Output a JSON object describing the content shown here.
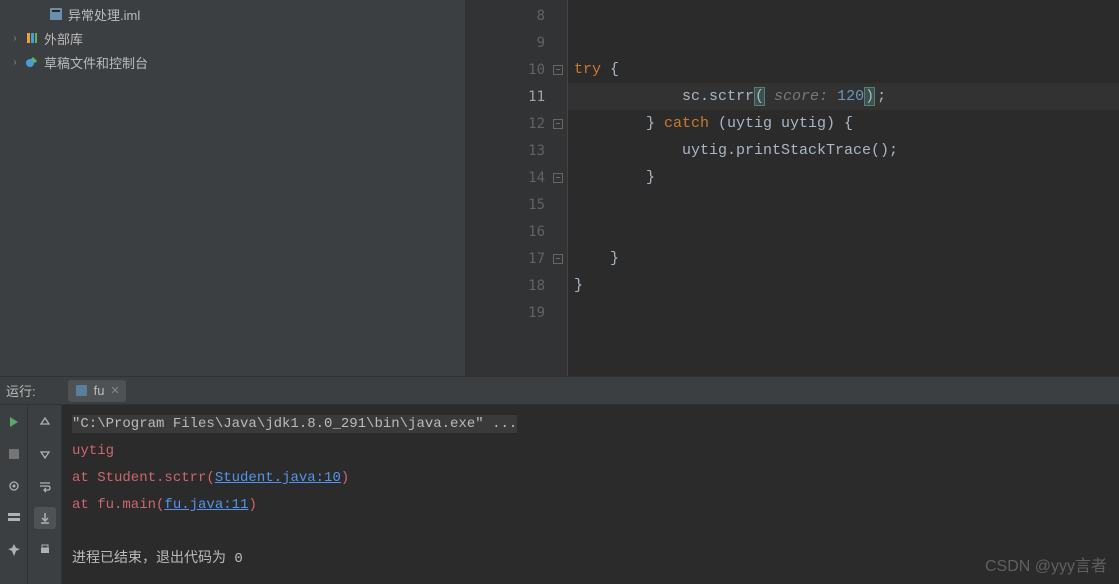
{
  "sidebar": {
    "items": [
      {
        "label": "异常处理.iml",
        "icon": "module-file-icon",
        "indent": "indent1",
        "chevron": ""
      },
      {
        "label": "外部库",
        "icon": "library-icon",
        "indent": "indent0",
        "chevron": "›"
      },
      {
        "label": "草稿文件和控制台",
        "icon": "scratch-icon",
        "indent": "indent0",
        "chevron": "›"
      }
    ]
  },
  "editor": {
    "lines": [
      {
        "num": "8",
        "fold": false,
        "current": false
      },
      {
        "num": "9",
        "fold": false,
        "current": false
      },
      {
        "num": "10",
        "fold": true,
        "current": false
      },
      {
        "num": "11",
        "fold": false,
        "current": true
      },
      {
        "num": "12",
        "fold": true,
        "current": false
      },
      {
        "num": "13",
        "fold": false,
        "current": false
      },
      {
        "num": "14",
        "fold": true,
        "current": false
      },
      {
        "num": "15",
        "fold": false,
        "current": false
      },
      {
        "num": "16",
        "fold": false,
        "current": false
      },
      {
        "num": "17",
        "fold": true,
        "current": false
      },
      {
        "num": "18",
        "fold": false,
        "current": false
      },
      {
        "num": "19",
        "fold": false,
        "current": false
      }
    ],
    "code": {
      "l10_kw": "try",
      "l10_rest": " {",
      "l11_pre": "            sc.sctrr",
      "l11_hint": " score: ",
      "l11_num": "120",
      "l11_end": ";",
      "l12_pre": "        } ",
      "l12_kw": "catch",
      "l12_rest": " (uytig uytig) {",
      "l13": "            uytig.printStackTrace();",
      "l14": "        }",
      "l17": "    }",
      "l18": "}"
    }
  },
  "run": {
    "label": "运行:",
    "tab": "fu",
    "cmd": "\"C:\\Program Files\\Java\\jdk1.8.0_291\\bin\\java.exe\" ...",
    "err_name": "uytig",
    "trace1_pre": "    at Student.sctrr(",
    "trace1_link": "Student.java:10",
    "trace1_post": ")",
    "trace2_pre": "    at fu.main(",
    "trace2_link": "fu.java:11",
    "trace2_post": ")",
    "exit_text": "进程已结束，退出代码为 ",
    "exit_code": "0"
  },
  "watermark": "CSDN @yyy言者"
}
